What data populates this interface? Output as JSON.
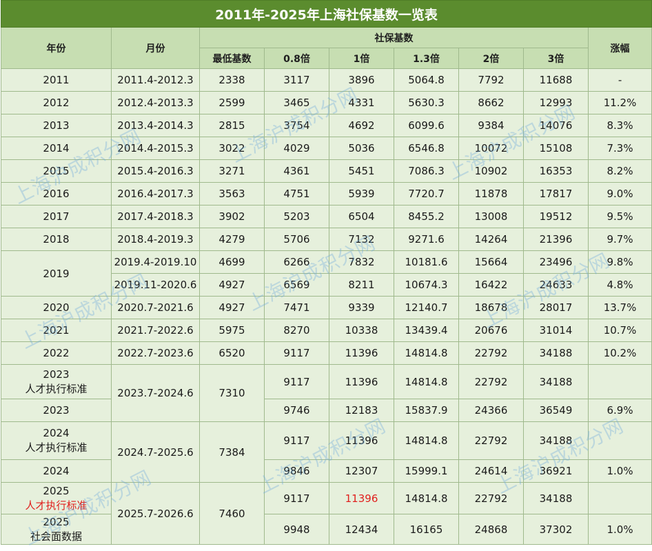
{
  "title": "2011年-2025年上海社保基数一览表",
  "headers": {
    "year": "年份",
    "month": "月份",
    "base_group": "社保基数",
    "min": "最低基数",
    "x08": "0.8倍",
    "x1": "1倍",
    "x13": "1.3倍",
    "x2": "2倍",
    "x3": "3倍",
    "growth": "涨幅"
  },
  "rows": [
    {
      "year": "2011",
      "period": "2011.4-2012.3",
      "min": "2338",
      "x08": "3117",
      "x1": "3896",
      "x13": "5064.8",
      "x2": "7792",
      "x3": "11688",
      "growth": "-"
    },
    {
      "year": "2012",
      "period": "2012.4-2013.3",
      "min": "2599",
      "x08": "3465",
      "x1": "4331",
      "x13": "5630.3",
      "x2": "8662",
      "x3": "12993",
      "growth": "11.2%"
    },
    {
      "year": "2013",
      "period": "2013.4-2014.3",
      "min": "2815",
      "x08": "3754",
      "x1": "4692",
      "x13": "6099.6",
      "x2": "9384",
      "x3": "14076",
      "growth": "8.3%"
    },
    {
      "year": "2014",
      "period": "2014.4-2015.3",
      "min": "3022",
      "x08": "4029",
      "x1": "5036",
      "x13": "6546.8",
      "x2": "10072",
      "x3": "15108",
      "growth": "7.3%"
    },
    {
      "year": "2015",
      "period": "2015.4-2016.3",
      "min": "3271",
      "x08": "4361",
      "x1": "5451",
      "x13": "7086.3",
      "x2": "10902",
      "x3": "16353",
      "growth": "8.2%"
    },
    {
      "year": "2016",
      "period": "2016.4-2017.3",
      "min": "3563",
      "x08": "4751",
      "x1": "5939",
      "x13": "7720.7",
      "x2": "11878",
      "x3": "17817",
      "growth": "9.0%"
    },
    {
      "year": "2017",
      "period": "2017.4-2018.3",
      "min": "3902",
      "x08": "5203",
      "x1": "6504",
      "x13": "8455.2",
      "x2": "13008",
      "x3": "19512",
      "growth": "9.5%"
    },
    {
      "year": "2018",
      "period": "2018.4-2019.3",
      "min": "4279",
      "x08": "5706",
      "x1": "7132",
      "x13": "9271.6",
      "x2": "14264",
      "x3": "21396",
      "growth": "9.7%"
    },
    {
      "year": "2019",
      "period": "2019.4-2019.10",
      "min": "4699",
      "x08": "6266",
      "x1": "7832",
      "x13": "10181.6",
      "x2": "15664",
      "x3": "23496",
      "growth": "9.8%"
    },
    {
      "year": "",
      "period": "2019.11-2020.6",
      "min": "4927",
      "x08": "6569",
      "x1": "8211",
      "x13": "10674.3",
      "x2": "16422",
      "x3": "24633",
      "growth": "4.8%"
    },
    {
      "year": "2020",
      "period": "2020.7-2021.6",
      "min": "4927",
      "x08": "7471",
      "x1": "9339",
      "x13": "12140.7",
      "x2": "18678",
      "x3": "28017",
      "growth": "13.7%"
    },
    {
      "year": "2021",
      "period": "2021.7-2022.6",
      "min": "5975",
      "x08": "8270",
      "x1": "10338",
      "x13": "13439.4",
      "x2": "20676",
      "x3": "31014",
      "growth": "10.7%"
    },
    {
      "year": "2022",
      "period": "2022.7-2023.6",
      "min": "6520",
      "x08": "9117",
      "x1": "11396",
      "x13": "14814.8",
      "x2": "22792",
      "x3": "34188",
      "growth": "10.2%"
    },
    {
      "year": "2023",
      "note": "人才执行标准",
      "period": "2023.7-2024.6",
      "min": "7310",
      "x08": "9117",
      "x1": "11396",
      "x13": "14814.8",
      "x2": "22792",
      "x3": "34188",
      "growth": ""
    },
    {
      "year": "2023",
      "period": "",
      "min": "",
      "x08": "9746",
      "x1": "12183",
      "x13": "15837.9",
      "x2": "24366",
      "x3": "36549",
      "growth": "6.9%"
    },
    {
      "year": "2024",
      "note": "人才执行标准",
      "period": "2024.7-2025.6",
      "min": "7384",
      "x08": "9117",
      "x1": "11396",
      "x13": "14814.8",
      "x2": "22792",
      "x3": "34188",
      "growth": ""
    },
    {
      "year": "2024",
      "period": "",
      "min": "",
      "x08": "9846",
      "x1": "12307",
      "x13": "15999.1",
      "x2": "24614",
      "x3": "36921",
      "growth": "1.0%"
    },
    {
      "year": "2025",
      "note": "人才执行标准",
      "period": "2025.7-2026.6",
      "min": "7460",
      "x08": "9117",
      "x1": "11396",
      "x13": "14814.8",
      "x2": "22792",
      "x3": "34188",
      "growth": ""
    },
    {
      "year": "2025",
      "note": "社会面数据",
      "period": "",
      "min": "",
      "x08": "9948",
      "x1": "12434",
      "x13": "16165",
      "x2": "24868",
      "x3": "37302",
      "growth": "1.0%"
    }
  ],
  "watermark": "上海沪成积分网",
  "colors": {
    "title_bg": "#5b8c2e",
    "header_bg": "#c7deb2",
    "cell_bg": "#e6f0dc",
    "highlight": "#e0201e"
  }
}
